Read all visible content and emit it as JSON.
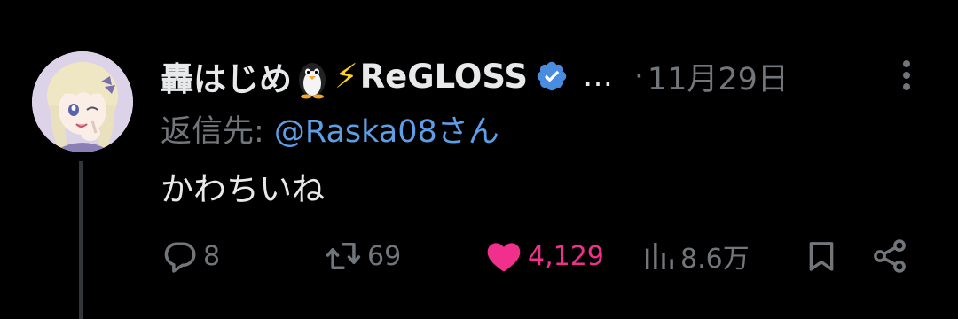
{
  "tweet": {
    "display_name": "轟はじめ",
    "name_emoji_1": "penguin",
    "name_emoji_2": "⚡",
    "group_name": "ReGLOSS",
    "verified_icon": "verified-badge-icon",
    "ellipsis": "…",
    "separator": "·",
    "timestamp": "11月29日",
    "reply_prefix": "返信先: ",
    "reply_handle": "@Raska08",
    "reply_suffix": "さん",
    "text": "かわちいね",
    "colors": {
      "background": "#000000",
      "text": "#e7e9ea",
      "muted": "#71767b",
      "link": "#5d9ee6",
      "verified": "#4a8de0",
      "like": "#f0308c"
    }
  },
  "actions": {
    "reply": {
      "icon": "reply-icon",
      "count": "8"
    },
    "retweet": {
      "icon": "retweet-icon",
      "count": "69"
    },
    "like": {
      "icon": "heart-icon",
      "count": "4,129",
      "liked": true
    },
    "views": {
      "icon": "views-icon",
      "count": "8.6万"
    },
    "bookmark": {
      "icon": "bookmark-icon"
    },
    "share": {
      "icon": "share-icon"
    }
  }
}
